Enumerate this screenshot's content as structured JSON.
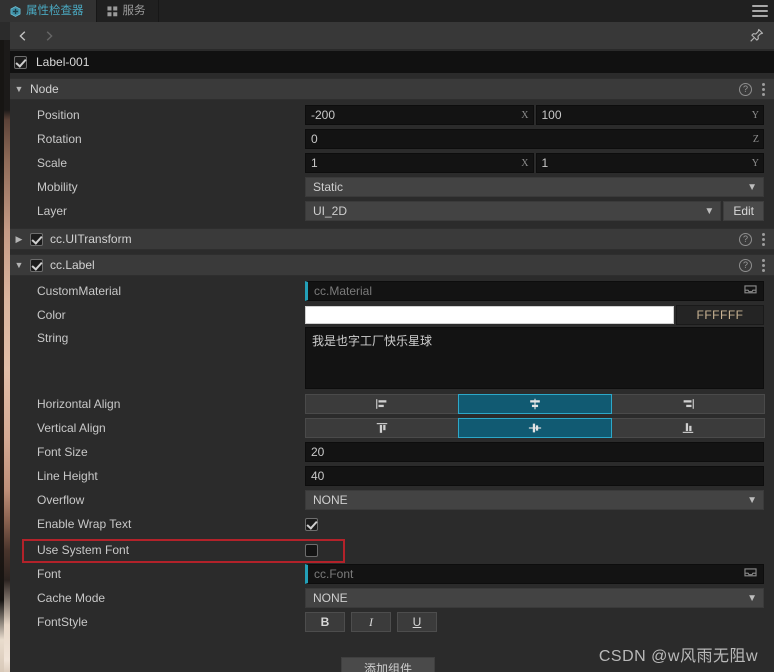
{
  "tabs": [
    {
      "label": "属性检查器",
      "icon": "hexagon-icon",
      "active": true
    },
    {
      "label": "服务",
      "icon": "grid-icon",
      "active": false
    }
  ],
  "window": {
    "menu_icon": "hamburger-icon",
    "pin_icon": "pin-icon",
    "back_icon": "chevron-left-icon",
    "forward_icon": "chevron-right-icon"
  },
  "node": {
    "name": "Label-001",
    "enabled": true
  },
  "sections": [
    {
      "title": "Node",
      "expanded": true,
      "has_checkbox": false,
      "checked": false
    },
    {
      "title": "cc.UITransform",
      "expanded": false,
      "has_checkbox": true,
      "checked": true
    },
    {
      "title": "cc.Label",
      "expanded": true,
      "has_checkbox": true,
      "checked": true
    }
  ],
  "node_props": {
    "position": {
      "label": "Position",
      "x": "-200",
      "y": "100",
      "axis_x": "X",
      "axis_y": "Y"
    },
    "rotation": {
      "label": "Rotation",
      "z": "0",
      "axis_z": "Z"
    },
    "scale": {
      "label": "Scale",
      "x": "1",
      "y": "1",
      "axis_x": "X",
      "axis_y": "Y"
    },
    "mobility": {
      "label": "Mobility",
      "value": "Static"
    },
    "layer": {
      "label": "Layer",
      "value": "UI_2D",
      "edit_label": "Edit"
    }
  },
  "label_props": {
    "custom_material": {
      "label": "CustomMaterial",
      "placeholder": "cc.Material"
    },
    "color": {
      "label": "Color",
      "hex": "FFFFFF",
      "swatch": "#FFFFFF"
    },
    "string": {
      "label": "String",
      "value": "我是也字工厂快乐星球"
    },
    "horizontal_align": {
      "label": "Horizontal Align",
      "options": [
        "align-left-icon",
        "align-center-icon",
        "align-right-icon"
      ],
      "selected_index": 1
    },
    "vertical_align": {
      "label": "Vertical Align",
      "options": [
        "align-top-icon",
        "align-middle-icon",
        "align-bottom-icon"
      ],
      "selected_index": 1
    },
    "font_size": {
      "label": "Font Size",
      "value": "20"
    },
    "line_height": {
      "label": "Line Height",
      "value": "40"
    },
    "overflow": {
      "label": "Overflow",
      "value": "NONE"
    },
    "enable_wrap_text": {
      "label": "Enable Wrap Text",
      "checked": true
    },
    "use_system_font": {
      "label": "Use System Font",
      "checked": false,
      "highlighted": true
    },
    "font": {
      "label": "Font",
      "placeholder": "cc.Font"
    },
    "cache_mode": {
      "label": "Cache Mode",
      "value": "NONE"
    },
    "font_style": {
      "label": "FontStyle",
      "bold": "B",
      "italic": "I",
      "underline": "U"
    }
  },
  "footer": {
    "add_component": "添加组件"
  },
  "watermark": "CSDN @w风雨无阻w",
  "colors": {
    "accent": "#23a0b8",
    "selected_button": "#115a72",
    "highlight_box": "#b3222a",
    "panel_bg": "#2b2b2b",
    "header_bg": "#3a3a3a"
  }
}
